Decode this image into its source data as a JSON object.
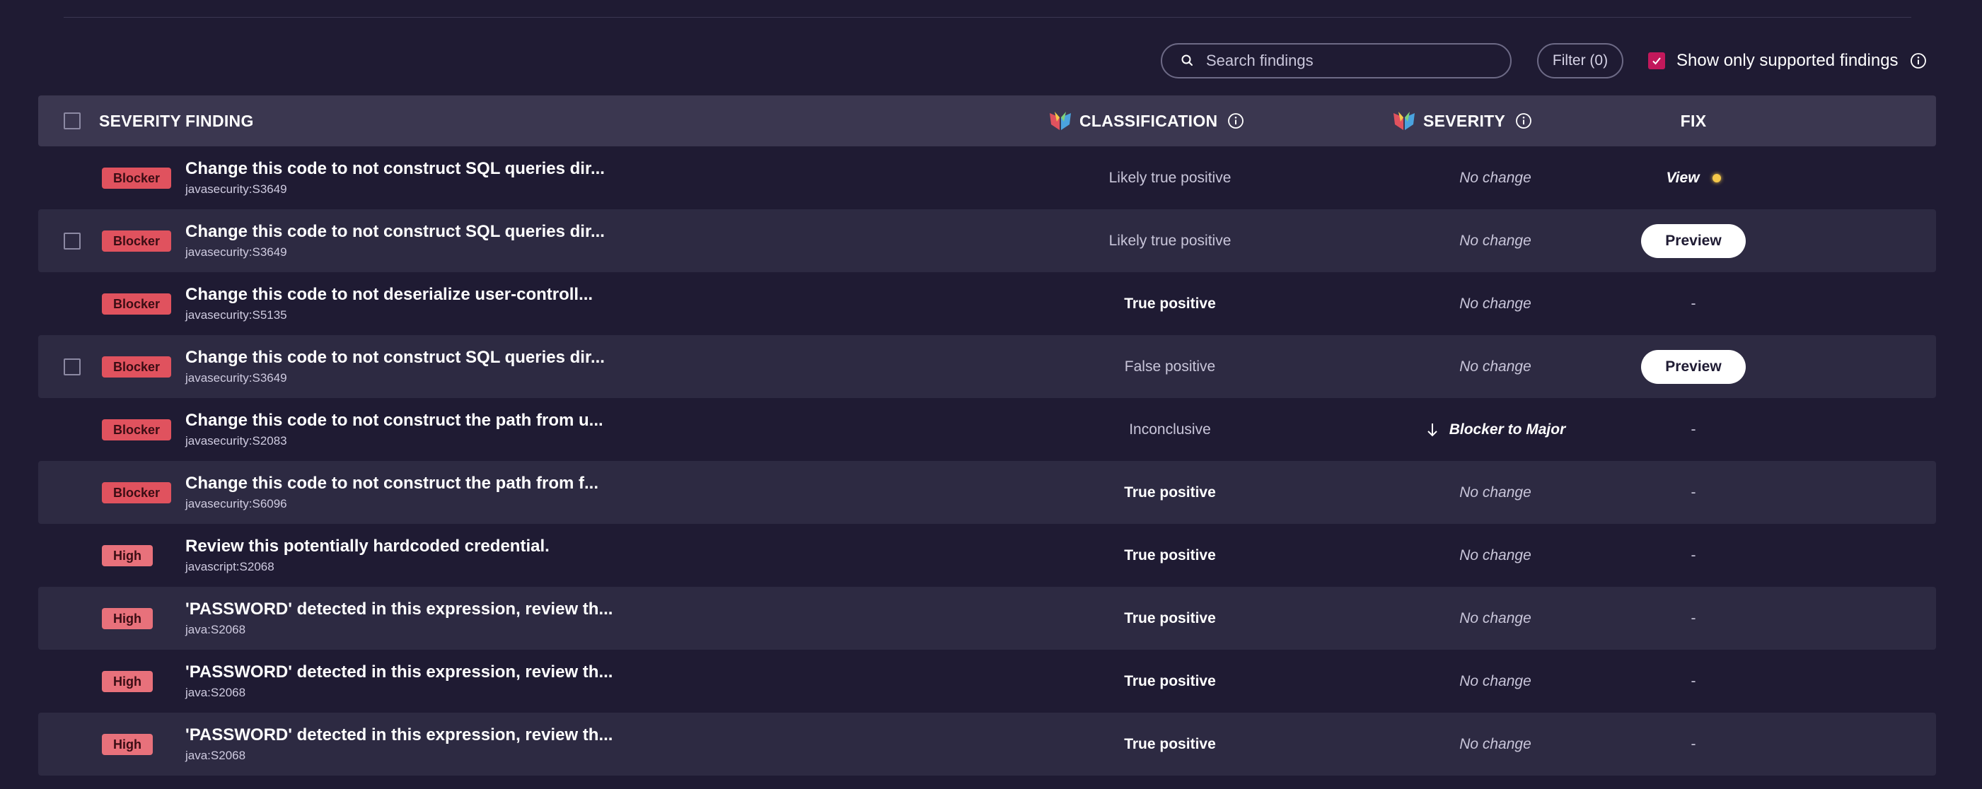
{
  "toolbar": {
    "search_placeholder": "Search findings",
    "filter_label": "Filter (0)",
    "supported_label": "Show only supported findings",
    "supported_checked": true
  },
  "table": {
    "headers": {
      "severity": "SEVERITY",
      "finding": "FINDING",
      "classification": "CLASSIFICATION",
      "ai_severity": "SEVERITY",
      "fix": "FIX"
    },
    "rows": [
      {
        "severity": "Blocker",
        "title": "Change this code to not construct SQL queries dir...",
        "rule": "javasecurity:S3649",
        "classification": "Likely true positive",
        "severity_change": "No change",
        "fix": "View"
      },
      {
        "severity": "Blocker",
        "title": "Change this code to not construct SQL queries dir...",
        "rule": "javasecurity:S3649",
        "classification": "Likely true positive",
        "severity_change": "No change",
        "fix": "Preview"
      },
      {
        "severity": "Blocker",
        "title": "Change this code to not deserialize user-controll...",
        "rule": "javasecurity:S5135",
        "classification": "True positive",
        "severity_change": "No change",
        "fix": "-"
      },
      {
        "severity": "Blocker",
        "title": "Change this code to not construct SQL queries dir...",
        "rule": "javasecurity:S3649",
        "classification": "False positive",
        "severity_change": "No change",
        "fix": "Preview"
      },
      {
        "severity": "Blocker",
        "title": "Change this code to not construct the path from u...",
        "rule": "javasecurity:S2083",
        "classification": "Inconclusive",
        "severity_change": "Blocker to Major",
        "fix": "-"
      },
      {
        "severity": "Blocker",
        "title": "Change this code to not construct the path from f...",
        "rule": "javasecurity:S6096",
        "classification": "True positive",
        "severity_change": "No change",
        "fix": "-"
      },
      {
        "severity": "High",
        "title": "Review this potentially hardcoded credential.",
        "rule": "javascript:S2068",
        "classification": "True positive",
        "severity_change": "No change",
        "fix": "-"
      },
      {
        "severity": "High",
        "title": "'PASSWORD' detected in this expression, review th...",
        "rule": "java:S2068",
        "classification": "True positive",
        "severity_change": "No change",
        "fix": "-"
      },
      {
        "severity": "High",
        "title": "'PASSWORD' detected in this expression, review th...",
        "rule": "java:S2068",
        "classification": "True positive",
        "severity_change": "No change",
        "fix": "-"
      },
      {
        "severity": "High",
        "title": "'PASSWORD' detected in this expression, review th...",
        "rule": "java:S2068",
        "classification": "True positive",
        "severity_change": "No change",
        "fix": "-"
      }
    ]
  },
  "icons": {
    "search": "search-icon",
    "info": "info-icon",
    "ai_logo": "ai-logo-icon",
    "arrow_down": "arrow-down-icon",
    "status_dot": "status-dot-icon"
  },
  "colors": {
    "background": "#1f1b33",
    "header_bg": "#3b3750",
    "stripe_bg": "#2d2a42",
    "blocker": "#e0525e",
    "high": "#e8717b",
    "accent_check": "#c2185b",
    "dot": "#f5c84a"
  }
}
